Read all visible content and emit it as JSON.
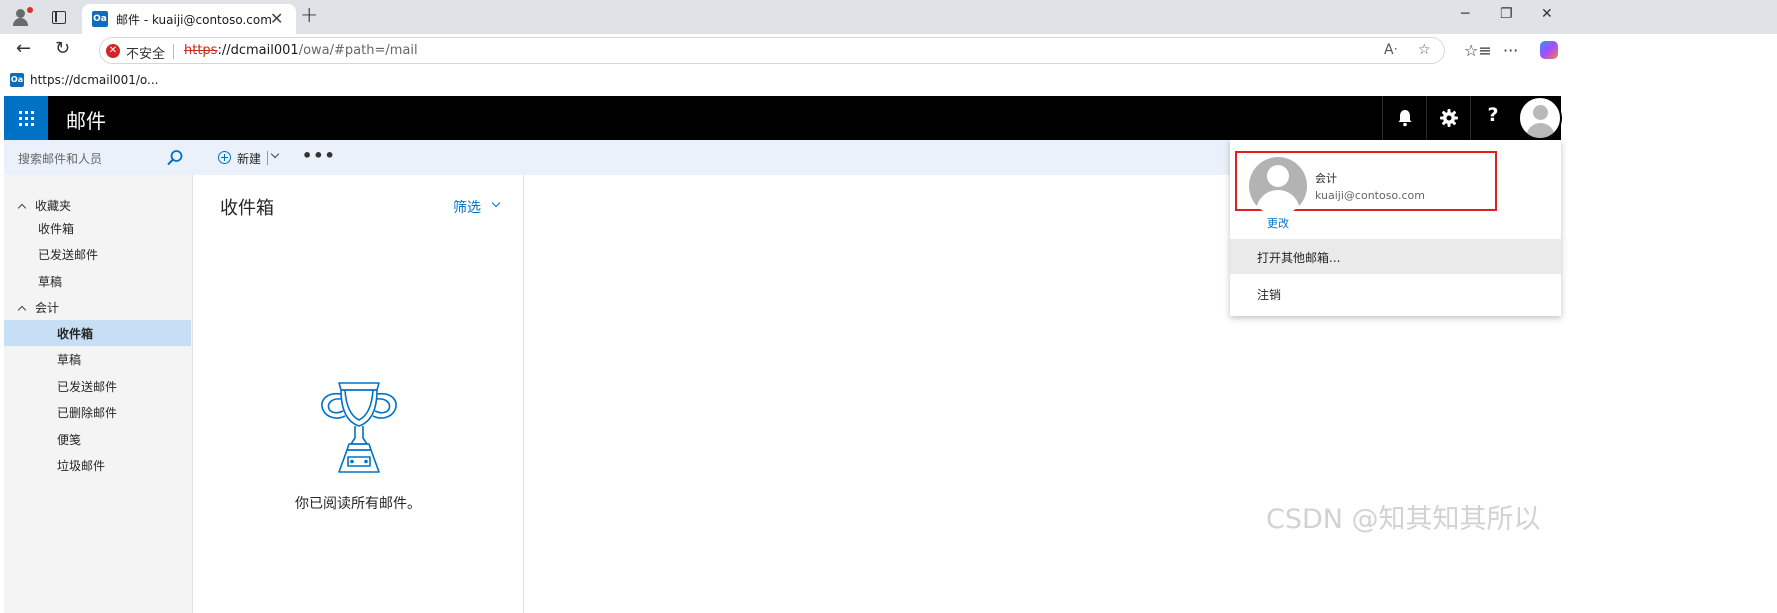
{
  "browser": {
    "tab_title": "邮件 - kuaiji@contoso.com",
    "tab_favicon_text": "Oa",
    "security_label": "不安全",
    "url_scheme": "https",
    "url_host": "://dcmail001",
    "url_path": "/owa/#path=/mail",
    "favorite_label": "https://dcmail001/o..."
  },
  "header": {
    "app_title": "邮件",
    "help_label": "?"
  },
  "search": {
    "placeholder": "搜索邮件和人员"
  },
  "nav": {
    "favorites_label": "收藏夹",
    "favorites": [
      "收件箱",
      "已发送邮件",
      "草稿"
    ],
    "account_label": "会计",
    "account_folders": [
      "收件箱",
      "草稿",
      "已发送邮件",
      "已删除邮件",
      "便笺",
      "垃圾邮件"
    ],
    "selected_folder": "收件箱"
  },
  "commands": {
    "new_label": "新建",
    "more_label": "•••"
  },
  "list": {
    "folder_title": "收件箱",
    "filter_label": "筛选",
    "empty_message": "你已阅读所有邮件。"
  },
  "account_menu": {
    "name": "会计",
    "email": "kuaiji@contoso.com",
    "change_label": "更改",
    "open_other_label": "打开其他邮箱...",
    "signout_label": "注销"
  },
  "watermark": "CSDN @知其知其所以",
  "colors": {
    "accent": "#0072c6",
    "header_bg": "#000000",
    "selection": "#c7dff4",
    "highlight_border": "#e0201b"
  }
}
